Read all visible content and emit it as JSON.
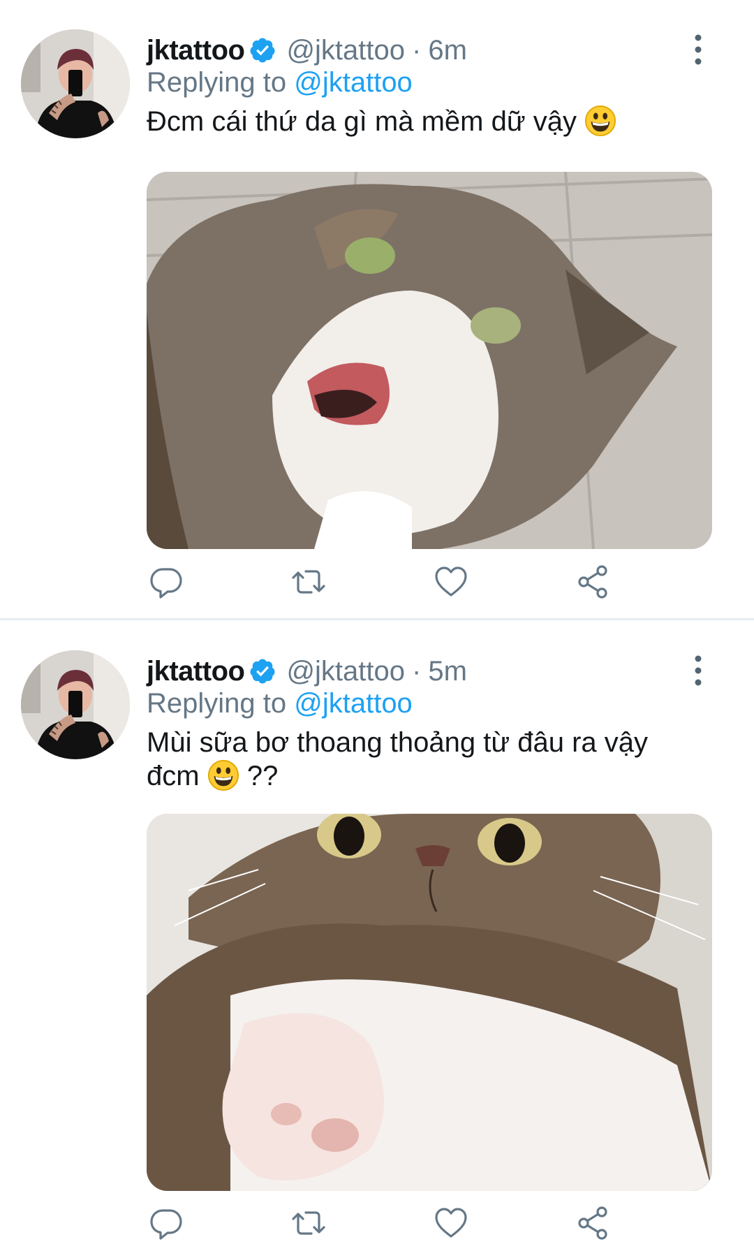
{
  "tweets": [
    {
      "author_name": "jktattoo",
      "author_handle": "@jktattoo",
      "separator": "·",
      "time": "6m",
      "replying_prefix": "Replying to ",
      "replying_handle": "@jktattoo",
      "text_line_1": "Đcm cái thứ da gì mà mềm dữ vậy",
      "text_line_2": "",
      "emoji": "grinning-face-icon",
      "media": "cat-photo"
    },
    {
      "author_name": "jktattoo",
      "author_handle": "@jktattoo",
      "separator": "·",
      "time": "5m",
      "replying_prefix": "Replying to ",
      "replying_handle": "@jktattoo",
      "text_line_1": "Mùi sữa bơ thoang thoảng từ đâu ra vậy",
      "text_line_2_before": "đcm",
      "text_line_2_after": "??",
      "emoji": "grinning-face-icon",
      "media": "cat-photo"
    }
  ],
  "actions": [
    "reply-icon",
    "retweet-icon",
    "like-icon",
    "share-icon"
  ],
  "colors": {
    "link": "#1da1f2",
    "secondary_text": "#657786",
    "primary_text": "#14171a",
    "divider": "#e6ecf0",
    "verified": "#1da1f2"
  }
}
